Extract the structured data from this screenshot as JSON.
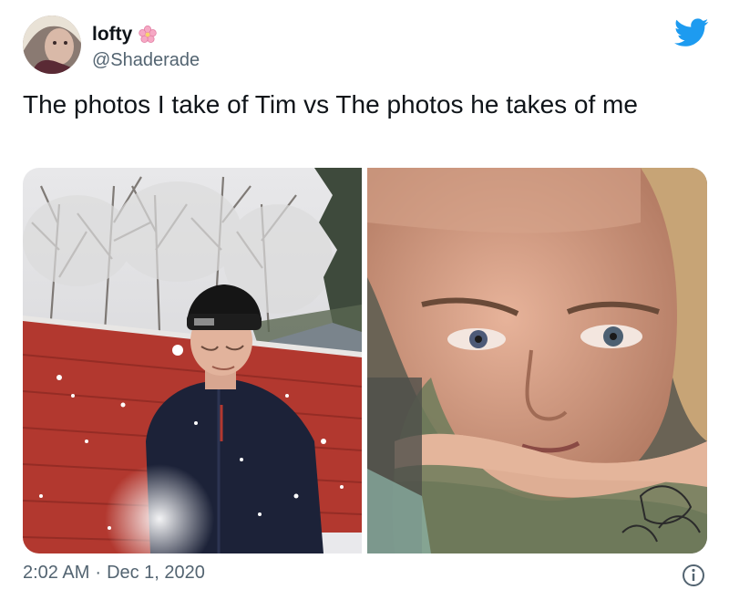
{
  "author": {
    "display_name": "lofty",
    "handle": "@Shaderade"
  },
  "tweet": {
    "text": "The photos I take of Tim vs The photos he takes of me"
  },
  "meta": {
    "time": "2:02 AM",
    "separator": "·",
    "date": "Dec 1, 2020"
  },
  "icons": {
    "brand": "twitter-bird-icon",
    "emoji": "cherry-blossom-icon",
    "info": "info-icon"
  },
  "colors": {
    "twitter_blue": "#1d9bf0",
    "secondary_text": "#536471",
    "primary_text": "#0f1419"
  }
}
